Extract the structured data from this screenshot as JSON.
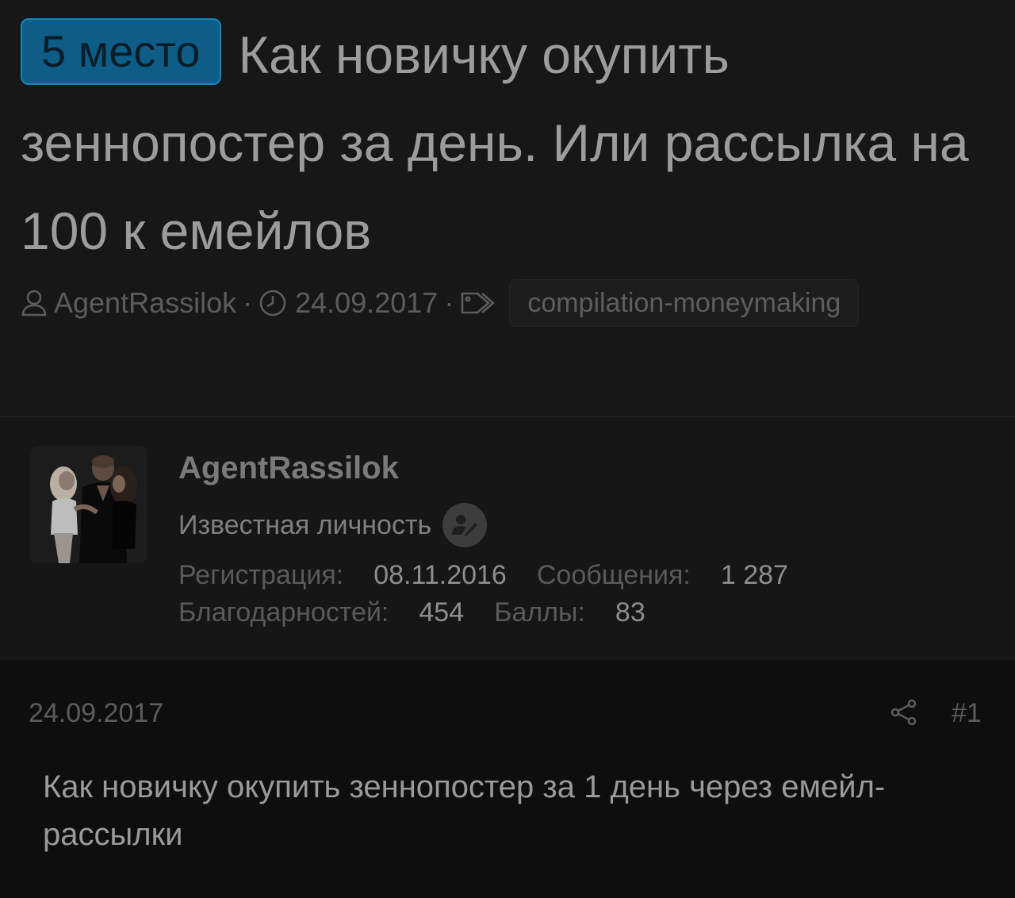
{
  "thread": {
    "prefix": "5 место",
    "title": "Как новичку окупить зеннопостер за день. Или рассылка на 100 к емейлов",
    "author": "AgentRassilok",
    "date": "24.09.2017",
    "separator": "·",
    "tag": "compilation-moneymaking",
    "colors": {
      "prefix_bg": "#0d5d87",
      "prefix_border": "#1784bd"
    }
  },
  "user": {
    "name": "AgentRassilok",
    "title": "Известная личность",
    "stats": {
      "registration_label": "Регистрация:",
      "registration_value": "08.11.2016",
      "messages_label": "Сообщения:",
      "messages_value": "1 287",
      "thanks_label": "Благодарностей:",
      "thanks_value": "454",
      "points_label": "Баллы:",
      "points_value": "83"
    }
  },
  "post": {
    "date": "24.09.2017",
    "number": "#1",
    "body": "Как новичку окупить зеннопостер за 1 день через емейл-рассылки"
  },
  "icons": {
    "author": "user-icon",
    "date": "clock-icon",
    "tag": "tag-icon",
    "badge": "user-edit-icon",
    "share": "share-icon"
  }
}
